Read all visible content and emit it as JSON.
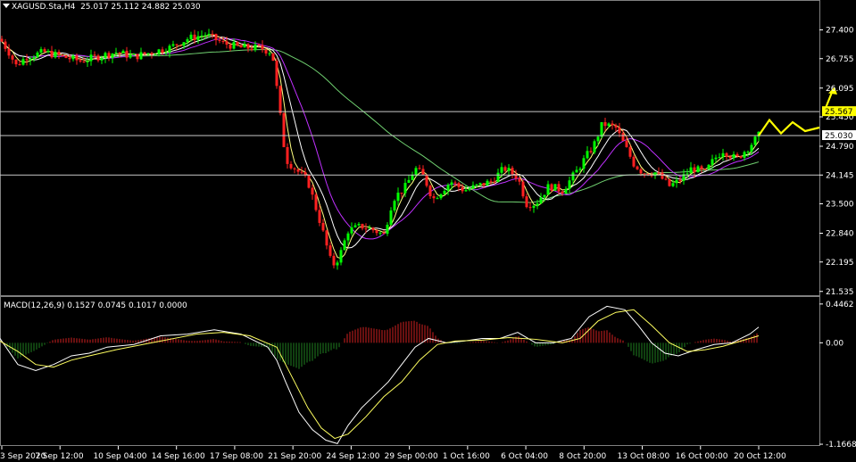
{
  "header": {
    "symbol": "XAGUSD.Sta,H4",
    "ohlc": "25.017 25.112 24.882 25.030"
  },
  "macd_header": {
    "label": "MACD(12,26,9)",
    "values": "0.1527 0.0745 0.1017 0.0000"
  },
  "colors": {
    "background": "#000000",
    "bull_candle": "#00ff00",
    "bear_candle": "#ff2020",
    "ma_fast": "#ffff80",
    "ma_mid": "#ffffff",
    "ma_slow_purple": "#c030ff",
    "ma_long_green": "#70d070",
    "histogram_up": "#d02020",
    "histogram_down": "#208020",
    "macd_line": "#ffffff",
    "signal_line": "#ffff60",
    "projection_arrow": "#ffff00"
  },
  "chart_data": [
    {
      "type": "candlestick",
      "title": "XAGUSD.Sta,H4",
      "y_axis_ticks": [
        "27.400",
        "26.755",
        "26.095",
        "25.450",
        "24.790",
        "24.145",
        "23.500",
        "22.840",
        "22.195",
        "21.535"
      ],
      "ylim": [
        21.5,
        27.7
      ],
      "x_axis_ticks": [
        "3 Sep 2020",
        "7 Sep 12:00",
        "10 Sep 04:00",
        "14 Sep 16:00",
        "17 Sep 08:00",
        "21 Sep 20:00",
        "24 Sep 12:00",
        "29 Sep 00:00",
        "1 Oct 16:00",
        "6 Oct 04:00",
        "8 Oct 20:00",
        "13 Oct 08:00",
        "16 Oct 00:00",
        "20 Oct 12:00"
      ],
      "price_path": [
        [
          0,
          27.2
        ],
        [
          10,
          26.9
        ],
        [
          18,
          26.6
        ],
        [
          30,
          26.8
        ],
        [
          50,
          26.9
        ],
        [
          70,
          26.8
        ],
        [
          90,
          26.7
        ],
        [
          110,
          26.8
        ],
        [
          130,
          26.9
        ],
        [
          150,
          26.8
        ],
        [
          170,
          26.9
        ],
        [
          190,
          27.0
        ],
        [
          210,
          27.2
        ],
        [
          230,
          27.3
        ],
        [
          250,
          27.1
        ],
        [
          270,
          27.0
        ],
        [
          290,
          27.0
        ],
        [
          305,
          26.9
        ],
        [
          315,
          25.3
        ],
        [
          320,
          24.5
        ],
        [
          330,
          24.3
        ],
        [
          345,
          24.0
        ],
        [
          360,
          23.0
        ],
        [
          372,
          22.1
        ],
        [
          380,
          22.3
        ],
        [
          390,
          22.9
        ],
        [
          405,
          23.0
        ],
        [
          420,
          22.9
        ],
        [
          430,
          22.8
        ],
        [
          440,
          23.6
        ],
        [
          455,
          23.9
        ],
        [
          465,
          24.3
        ],
        [
          475,
          24.1
        ],
        [
          485,
          23.6
        ],
        [
          495,
          23.8
        ],
        [
          505,
          24.0
        ],
        [
          520,
          23.8
        ],
        [
          535,
          23.9
        ],
        [
          550,
          24.0
        ],
        [
          565,
          24.3
        ],
        [
          580,
          24.1
        ],
        [
          590,
          23.5
        ],
        [
          600,
          23.5
        ],
        [
          615,
          23.9
        ],
        [
          630,
          23.8
        ],
        [
          645,
          24.2
        ],
        [
          658,
          24.6
        ],
        [
          665,
          24.8
        ],
        [
          675,
          25.3
        ],
        [
          690,
          25.2
        ],
        [
          700,
          24.8
        ],
        [
          710,
          24.4
        ],
        [
          720,
          24.2
        ],
        [
          735,
          24.2
        ],
        [
          750,
          23.9
        ],
        [
          760,
          24.0
        ],
        [
          775,
          24.3
        ],
        [
          790,
          24.2
        ],
        [
          800,
          24.5
        ],
        [
          810,
          24.7
        ],
        [
          825,
          24.5
        ],
        [
          840,
          24.8
        ],
        [
          850,
          25.03
        ]
      ],
      "horizontal_levels": [
        25.567,
        25.03,
        24.145
      ],
      "price_labels": [
        "25.567",
        "25.030"
      ],
      "projection": "zigzag-up"
    },
    {
      "type": "macd",
      "title": "MACD(12,26,9)",
      "y_axis_ticks": [
        "0.4462",
        "0.00",
        "-1.1668"
      ],
      "ylim": [
        -1.1668,
        0.4462
      ],
      "macd_path": [
        [
          0,
          0.05
        ],
        [
          20,
          -0.25
        ],
        [
          40,
          -0.32
        ],
        [
          60,
          -0.25
        ],
        [
          80,
          -0.15
        ],
        [
          100,
          -0.12
        ],
        [
          120,
          -0.05
        ],
        [
          150,
          -0.02
        ],
        [
          180,
          0.08
        ],
        [
          210,
          0.1
        ],
        [
          240,
          0.15
        ],
        [
          270,
          0.1
        ],
        [
          300,
          -0.05
        ],
        [
          310,
          -0.2
        ],
        [
          320,
          -0.45
        ],
        [
          335,
          -0.8
        ],
        [
          350,
          -1.0
        ],
        [
          365,
          -1.12
        ],
        [
          378,
          -1.16
        ],
        [
          390,
          -0.95
        ],
        [
          405,
          -0.75
        ],
        [
          420,
          -0.6
        ],
        [
          435,
          -0.45
        ],
        [
          450,
          -0.25
        ],
        [
          465,
          -0.05
        ],
        [
          480,
          0.05
        ],
        [
          500,
          0.0
        ],
        [
          520,
          0.02
        ],
        [
          540,
          0.05
        ],
        [
          560,
          0.05
        ],
        [
          580,
          0.12
        ],
        [
          600,
          0.0
        ],
        [
          620,
          0.0
        ],
        [
          640,
          0.05
        ],
        [
          660,
          0.3
        ],
        [
          680,
          0.42
        ],
        [
          700,
          0.38
        ],
        [
          715,
          0.2
        ],
        [
          730,
          0.0
        ],
        [
          745,
          -0.12
        ],
        [
          760,
          -0.15
        ],
        [
          780,
          -0.08
        ],
        [
          800,
          -0.02
        ],
        [
          820,
          0.0
        ],
        [
          840,
          0.1
        ],
        [
          850,
          0.18
        ]
      ],
      "signal_path": [
        [
          0,
          0.02
        ],
        [
          20,
          -0.1
        ],
        [
          40,
          -0.25
        ],
        [
          60,
          -0.28
        ],
        [
          80,
          -0.2
        ],
        [
          100,
          -0.15
        ],
        [
          130,
          -0.08
        ],
        [
          160,
          -0.02
        ],
        [
          190,
          0.04
        ],
        [
          220,
          0.1
        ],
        [
          250,
          0.12
        ],
        [
          280,
          0.08
        ],
        [
          310,
          -0.05
        ],
        [
          330,
          -0.45
        ],
        [
          345,
          -0.75
        ],
        [
          360,
          -0.98
        ],
        [
          375,
          -1.1
        ],
        [
          390,
          -1.05
        ],
        [
          410,
          -0.85
        ],
        [
          430,
          -0.62
        ],
        [
          450,
          -0.45
        ],
        [
          470,
          -0.2
        ],
        [
          490,
          -0.02
        ],
        [
          510,
          0.02
        ],
        [
          540,
          0.03
        ],
        [
          570,
          0.06
        ],
        [
          600,
          0.04
        ],
        [
          630,
          0.0
        ],
        [
          650,
          0.05
        ],
        [
          670,
          0.25
        ],
        [
          690,
          0.35
        ],
        [
          710,
          0.38
        ],
        [
          730,
          0.2
        ],
        [
          750,
          0.0
        ],
        [
          770,
          -0.1
        ],
        [
          790,
          -0.08
        ],
        [
          810,
          -0.04
        ],
        [
          830,
          0.02
        ],
        [
          850,
          0.08
        ]
      ]
    }
  ]
}
